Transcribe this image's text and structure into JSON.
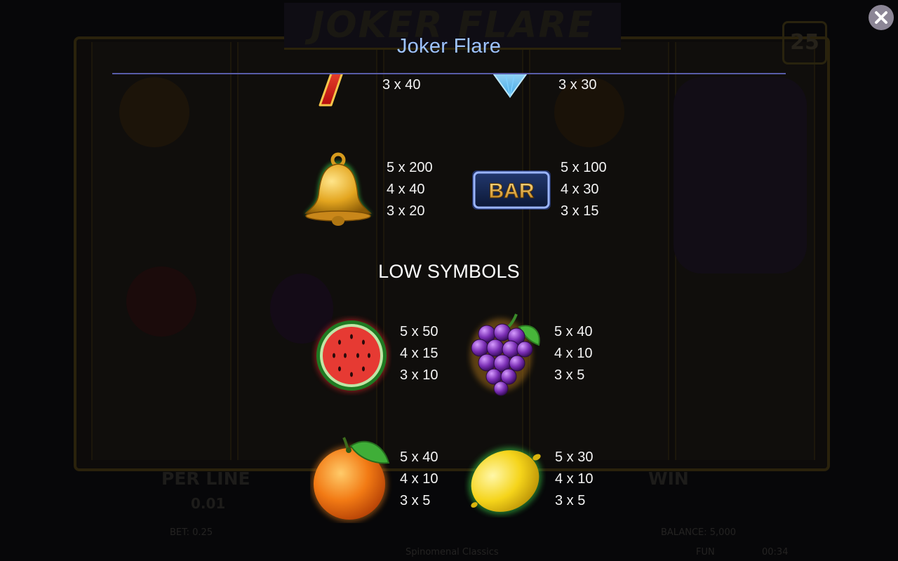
{
  "title": "Joker Flare",
  "close_button": {
    "icon": "close-icon"
  },
  "sections": {
    "low_heading": "LOW SYMBOLS"
  },
  "high_symbols": [
    {
      "name": "seven",
      "icon": "seven-icon",
      "payouts": [
        "3 x 40"
      ]
    },
    {
      "name": "diamond",
      "icon": "diamond-icon",
      "payouts": [
        "3 x 30"
      ]
    },
    {
      "name": "bell",
      "icon": "bell-icon",
      "payouts": [
        "5 x 200",
        "4 x 40",
        "3 x 20"
      ]
    },
    {
      "name": "bar",
      "icon": "bar-icon",
      "label": "BAR",
      "payouts": [
        "5 x 100",
        "4 x 30",
        "3 x 15"
      ]
    }
  ],
  "low_symbols": [
    {
      "name": "watermelon",
      "icon": "watermelon-icon",
      "payouts": [
        "5 x 50",
        "4 x 15",
        "3 x 10"
      ]
    },
    {
      "name": "grapes",
      "icon": "grapes-icon",
      "payouts": [
        "5 x 40",
        "4 x 10",
        "3 x 5"
      ]
    },
    {
      "name": "orange",
      "icon": "orange-icon",
      "payouts": [
        "5 x 40",
        "4 x 10",
        "3 x 5"
      ]
    },
    {
      "name": "lemon",
      "icon": "lemon-icon",
      "payouts": [
        "5 x 30",
        "4 x 10",
        "3 x 5"
      ]
    }
  ],
  "background": {
    "game_logo": "JOKER FLARE",
    "lines": "25",
    "per_line_label": "PER LINE",
    "per_line_value": "0.01",
    "win_label": "WIN",
    "bet_text": "BET: 0.25",
    "balance_text": "BALANCE: 5,000",
    "brand": "Spinomenal Classics",
    "mode": "FUN",
    "clock": "00:34"
  },
  "colors": {
    "title": "#9ec3ff",
    "rule": "#585ca8",
    "text": "#f4f4f4",
    "background": "#070709"
  }
}
